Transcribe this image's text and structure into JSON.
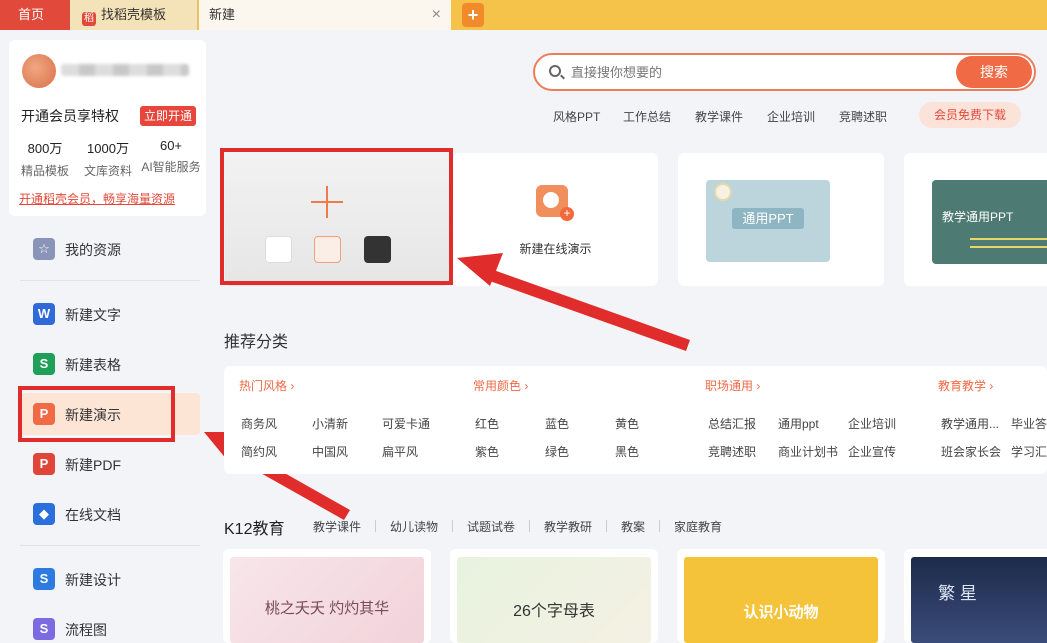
{
  "tabs": {
    "home": "首页",
    "template": "找稻壳模板",
    "current": "新建",
    "close": "×",
    "add": "+"
  },
  "member": {
    "title": "开通会员享特权",
    "open_btn": "立即开通",
    "stats": [
      {
        "num": "800万",
        "label": "精品模板"
      },
      {
        "num": "1000万",
        "label": "文库资料"
      },
      {
        "num": "60+",
        "label": "AI智能服务"
      }
    ],
    "link": "开通稻壳会员，畅享海量资源"
  },
  "sidebar": {
    "items": [
      {
        "label": "我的资源",
        "icon": "star-icon",
        "glyph": "☆",
        "color": "#8a94b8"
      },
      {
        "label": "新建文字",
        "icon": "writer-w-icon",
        "glyph": "W",
        "color": "#2f6ad8"
      },
      {
        "label": "新建表格",
        "icon": "sheet-s-icon",
        "glyph": "S",
        "color": "#1f9f5a"
      },
      {
        "label": "新建演示",
        "icon": "presentation-p-icon",
        "glyph": "P",
        "color": "#ef6a45"
      },
      {
        "label": "新建PDF",
        "icon": "pdf-icon",
        "glyph": "P",
        "color": "#e0453a"
      },
      {
        "label": "在线文档",
        "icon": "cloud-doc-icon",
        "glyph": "◆",
        "color": "#2a6fdb"
      },
      {
        "label": "新建设计",
        "icon": "design-icon",
        "glyph": "S",
        "color": "#2d7be0"
      },
      {
        "label": "流程图",
        "icon": "flowchart-icon",
        "glyph": "S",
        "color": "#7b6be0"
      }
    ]
  },
  "search": {
    "placeholder": "直接搜你想要的",
    "button": "搜索",
    "hot_tags": [
      "风格PPT",
      "工作总结",
      "教学课件",
      "企业培训",
      "竞聘述职"
    ],
    "vip_download": "会员免费下载"
  },
  "cards": {
    "online_label": "新建在线演示",
    "tpl1_label": "通用PPT",
    "tpl2_label": "教学通用PPT"
  },
  "recommend": {
    "title": "推荐分类",
    "columns": [
      {
        "head": "热门风格 ›",
        "rows": [
          [
            "商务风",
            "小清新",
            "可爱卡通"
          ],
          [
            "简约风",
            "中国风",
            "扁平风"
          ]
        ]
      },
      {
        "head": "常用颜色 ›",
        "rows": [
          [
            "红色",
            "蓝色",
            "黄色"
          ],
          [
            "紫色",
            "绿色",
            "黑色"
          ]
        ]
      },
      {
        "head": "职场通用 ›",
        "rows": [
          [
            "总结汇报",
            "通用ppt",
            "企业培训"
          ],
          [
            "竞聘述职",
            "商业计划书",
            "企业宣传"
          ]
        ]
      },
      {
        "head": "教育教学 ›",
        "rows": [
          [
            "教学通用...",
            "毕业答"
          ],
          [
            "班会家长会",
            "学习汇"
          ]
        ]
      }
    ]
  },
  "k12": {
    "title": "K12教育",
    "tabs": [
      "教学课件",
      "幼儿读物",
      "试题试卷",
      "教学教研",
      "教案",
      "家庭教育"
    ],
    "thumbs": [
      "桃之夭夭 灼灼其华",
      "26个字母表",
      "认识小动物",
      "繁 星"
    ]
  },
  "colors": {
    "accent": "#ef6a45",
    "annotation_red": "#e12c2c"
  }
}
